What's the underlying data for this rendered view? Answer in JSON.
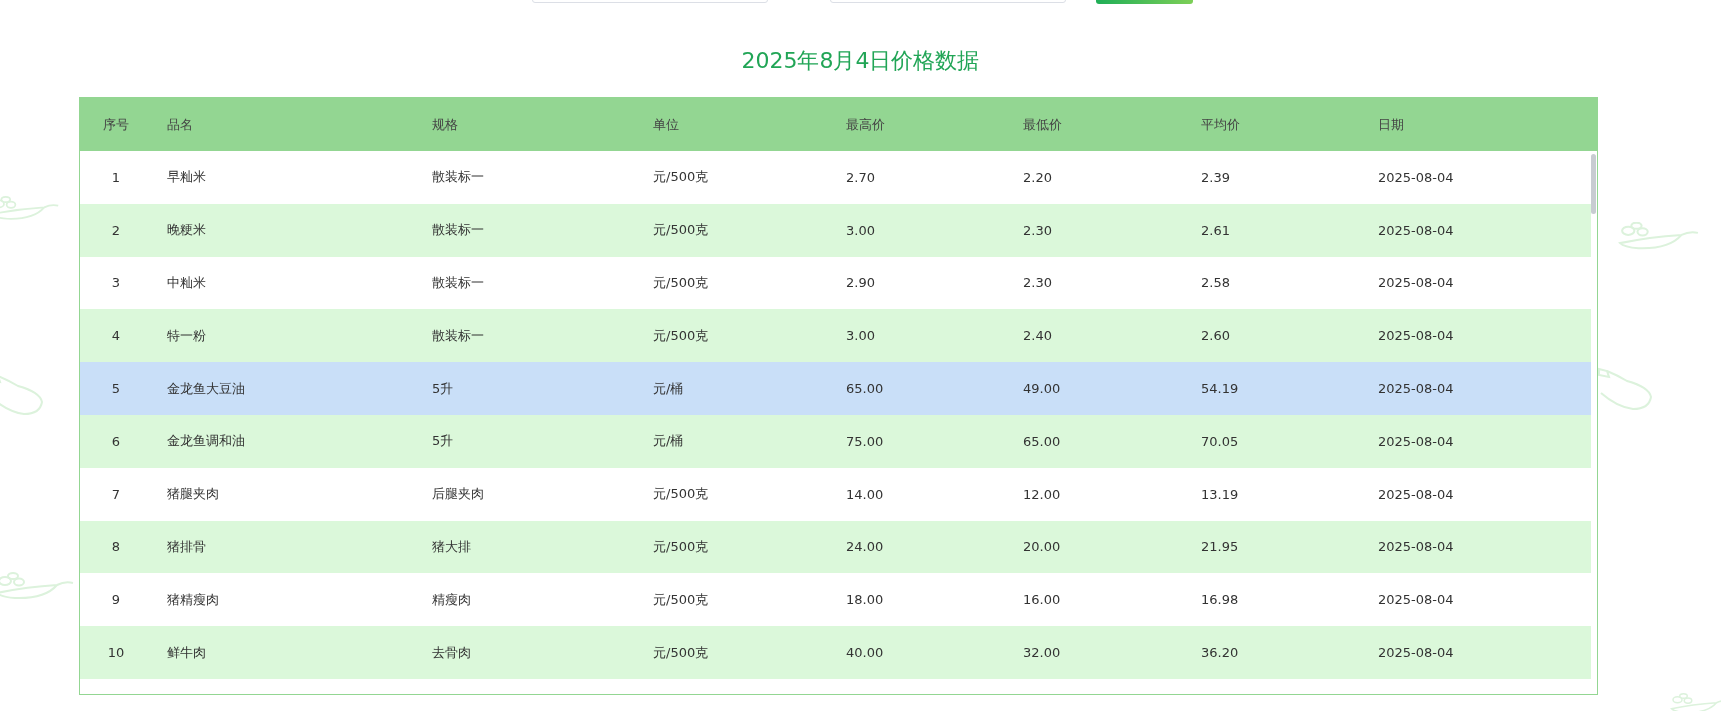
{
  "filters": {
    "fields": [
      {
        "kind": "text"
      },
      {
        "kind": "text"
      }
    ]
  },
  "title": "2025年8月4日价格数据",
  "table": {
    "columns": [
      "序号",
      "品名",
      "规格",
      "单位",
      "最高价",
      "最低价",
      "平均价",
      "日期"
    ],
    "rows": [
      {
        "cells": [
          "1",
          "早籼米",
          "散装标一",
          "元/500克",
          "2.70",
          "2.20",
          "2.39",
          "2025-08-04"
        ],
        "selected": false
      },
      {
        "cells": [
          "2",
          "晚粳米",
          "散装标一",
          "元/500克",
          "3.00",
          "2.30",
          "2.61",
          "2025-08-04"
        ],
        "selected": false
      },
      {
        "cells": [
          "3",
          "中籼米",
          "散装标一",
          "元/500克",
          "2.90",
          "2.30",
          "2.58",
          "2025-08-04"
        ],
        "selected": false
      },
      {
        "cells": [
          "4",
          "特一粉",
          "散装标一",
          "元/500克",
          "3.00",
          "2.40",
          "2.60",
          "2025-08-04"
        ],
        "selected": false
      },
      {
        "cells": [
          "5",
          "金龙鱼大豆油",
          "5升",
          "元/桶",
          "65.00",
          "49.00",
          "54.19",
          "2025-08-04"
        ],
        "selected": true
      },
      {
        "cells": [
          "6",
          "金龙鱼调和油",
          "5升",
          "元/桶",
          "75.00",
          "65.00",
          "70.05",
          "2025-08-04"
        ],
        "selected": false
      },
      {
        "cells": [
          "7",
          "猪腿夹肉",
          "后腿夹肉",
          "元/500克",
          "14.00",
          "12.00",
          "13.19",
          "2025-08-04"
        ],
        "selected": false
      },
      {
        "cells": [
          "8",
          "猪排骨",
          "猪大排",
          "元/500克",
          "24.00",
          "20.00",
          "21.95",
          "2025-08-04"
        ],
        "selected": false
      },
      {
        "cells": [
          "9",
          "猪精瘦肉",
          "精瘦肉",
          "元/500克",
          "18.00",
          "16.00",
          "16.98",
          "2025-08-04"
        ],
        "selected": false
      },
      {
        "cells": [
          "10",
          "鲜牛肉",
          "去骨肉",
          "元/500克",
          "40.00",
          "32.00",
          "36.20",
          "2025-08-04"
        ],
        "selected": false
      }
    ]
  }
}
